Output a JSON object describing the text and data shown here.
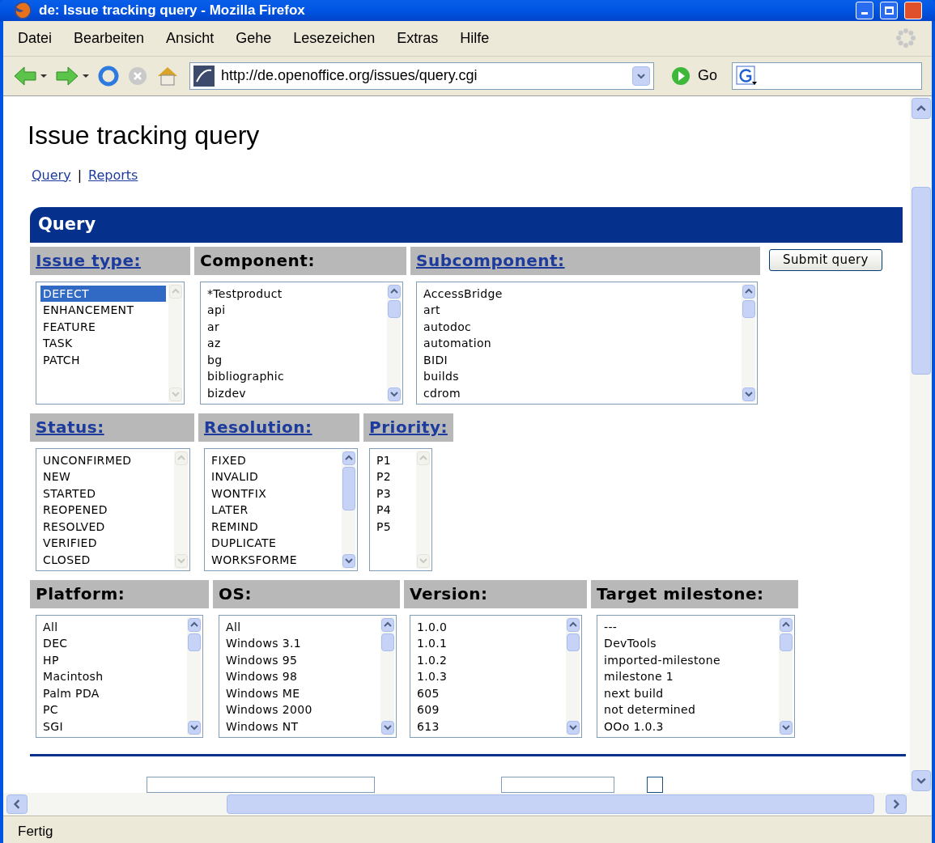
{
  "window": {
    "title": "de: Issue tracking query - Mozilla Firefox"
  },
  "menu": [
    "Datei",
    "Bearbeiten",
    "Ansicht",
    "Gehe",
    "Lesezeichen",
    "Extras",
    "Hilfe"
  ],
  "toolbar": {
    "address": "http://de.openoffice.org/issues/query.cgi",
    "go": "Go"
  },
  "page": {
    "heading": "Issue tracking query",
    "links": [
      "Query",
      "Reports"
    ],
    "separator": "|",
    "panel_title": "Query",
    "submit": "Submit query"
  },
  "rows": [
    [
      {
        "label": "Issue type:",
        "link": true,
        "scrollable": false,
        "items": [
          {
            "text": "DEFECT",
            "selected": true
          },
          {
            "text": "ENHANCEMENT",
            "selected": false
          },
          {
            "text": "FEATURE",
            "selected": false
          },
          {
            "text": "TASK",
            "selected": false
          },
          {
            "text": "PATCH",
            "selected": false
          }
        ]
      },
      {
        "label": "Component:",
        "link": false,
        "scrollable": true,
        "items": [
          {
            "text": "*Testproduct",
            "selected": false
          },
          {
            "text": "api",
            "selected": false
          },
          {
            "text": "ar",
            "selected": false
          },
          {
            "text": "az",
            "selected": false
          },
          {
            "text": "bg",
            "selected": false
          },
          {
            "text": "bibliographic",
            "selected": false
          },
          {
            "text": "bizdev",
            "selected": false
          }
        ]
      },
      {
        "label": "Subcomponent:",
        "link": true,
        "scrollable": true,
        "items": [
          {
            "text": "AccessBridge",
            "selected": false
          },
          {
            "text": "art",
            "selected": false
          },
          {
            "text": "autodoc",
            "selected": false
          },
          {
            "text": "automation",
            "selected": false
          },
          {
            "text": "BIDI",
            "selected": false
          },
          {
            "text": "builds",
            "selected": false
          },
          {
            "text": "cdrom",
            "selected": false
          }
        ]
      }
    ],
    [
      {
        "label": "Status:",
        "link": true,
        "scrollable": false,
        "items": [
          {
            "text": "UNCONFIRMED",
            "selected": false
          },
          {
            "text": "NEW",
            "selected": false
          },
          {
            "text": "STARTED",
            "selected": false
          },
          {
            "text": "REOPENED",
            "selected": false
          },
          {
            "text": "RESOLVED",
            "selected": false
          },
          {
            "text": "VERIFIED",
            "selected": false
          },
          {
            "text": "CLOSED",
            "selected": false
          }
        ]
      },
      {
        "label": "Resolution:",
        "link": true,
        "scrollable": true,
        "items": [
          {
            "text": "FIXED",
            "selected": false
          },
          {
            "text": "INVALID",
            "selected": false
          },
          {
            "text": "WONTFIX",
            "selected": false
          },
          {
            "text": "LATER",
            "selected": false
          },
          {
            "text": "REMIND",
            "selected": false
          },
          {
            "text": "DUPLICATE",
            "selected": false
          },
          {
            "text": "WORKSFORME",
            "selected": false
          }
        ]
      },
      {
        "label": "Priority:",
        "link": true,
        "scrollable": false,
        "items": [
          {
            "text": "P1",
            "selected": false
          },
          {
            "text": "P2",
            "selected": false
          },
          {
            "text": "P3",
            "selected": false
          },
          {
            "text": "P4",
            "selected": false
          },
          {
            "text": "P5",
            "selected": false
          }
        ]
      }
    ],
    [
      {
        "label": "Platform:",
        "link": false,
        "scrollable": true,
        "items": [
          {
            "text": "All",
            "selected": false
          },
          {
            "text": "DEC",
            "selected": false
          },
          {
            "text": "HP",
            "selected": false
          },
          {
            "text": "Macintosh",
            "selected": false
          },
          {
            "text": "Palm PDA",
            "selected": false
          },
          {
            "text": "PC",
            "selected": false
          },
          {
            "text": "SGI",
            "selected": false
          }
        ]
      },
      {
        "label": "OS:",
        "link": false,
        "scrollable": true,
        "items": [
          {
            "text": "All",
            "selected": false
          },
          {
            "text": "Windows 3.1",
            "selected": false
          },
          {
            "text": "Windows 95",
            "selected": false
          },
          {
            "text": "Windows 98",
            "selected": false
          },
          {
            "text": "Windows ME",
            "selected": false
          },
          {
            "text": "Windows 2000",
            "selected": false
          },
          {
            "text": "Windows NT",
            "selected": false
          }
        ]
      },
      {
        "label": "Version:",
        "link": false,
        "scrollable": true,
        "items": [
          {
            "text": "1.0.0",
            "selected": false
          },
          {
            "text": "1.0.1",
            "selected": false
          },
          {
            "text": "1.0.2",
            "selected": false
          },
          {
            "text": "1.0.3",
            "selected": false
          },
          {
            "text": "605",
            "selected": false
          },
          {
            "text": "609",
            "selected": false
          },
          {
            "text": "613",
            "selected": false
          }
        ]
      },
      {
        "label": "Target milestone:",
        "link": false,
        "scrollable": true,
        "items": [
          {
            "text": "---",
            "selected": false
          },
          {
            "text": "DevTools",
            "selected": false
          },
          {
            "text": "imported-milestone",
            "selected": false
          },
          {
            "text": "milestone 1",
            "selected": false
          },
          {
            "text": "next build",
            "selected": false
          },
          {
            "text": "not determined",
            "selected": false
          },
          {
            "text": "OOo 1.0.3",
            "selected": false
          }
        ]
      }
    ]
  ],
  "filter": {
    "checked": false
  },
  "status_bar": "Fertig"
}
